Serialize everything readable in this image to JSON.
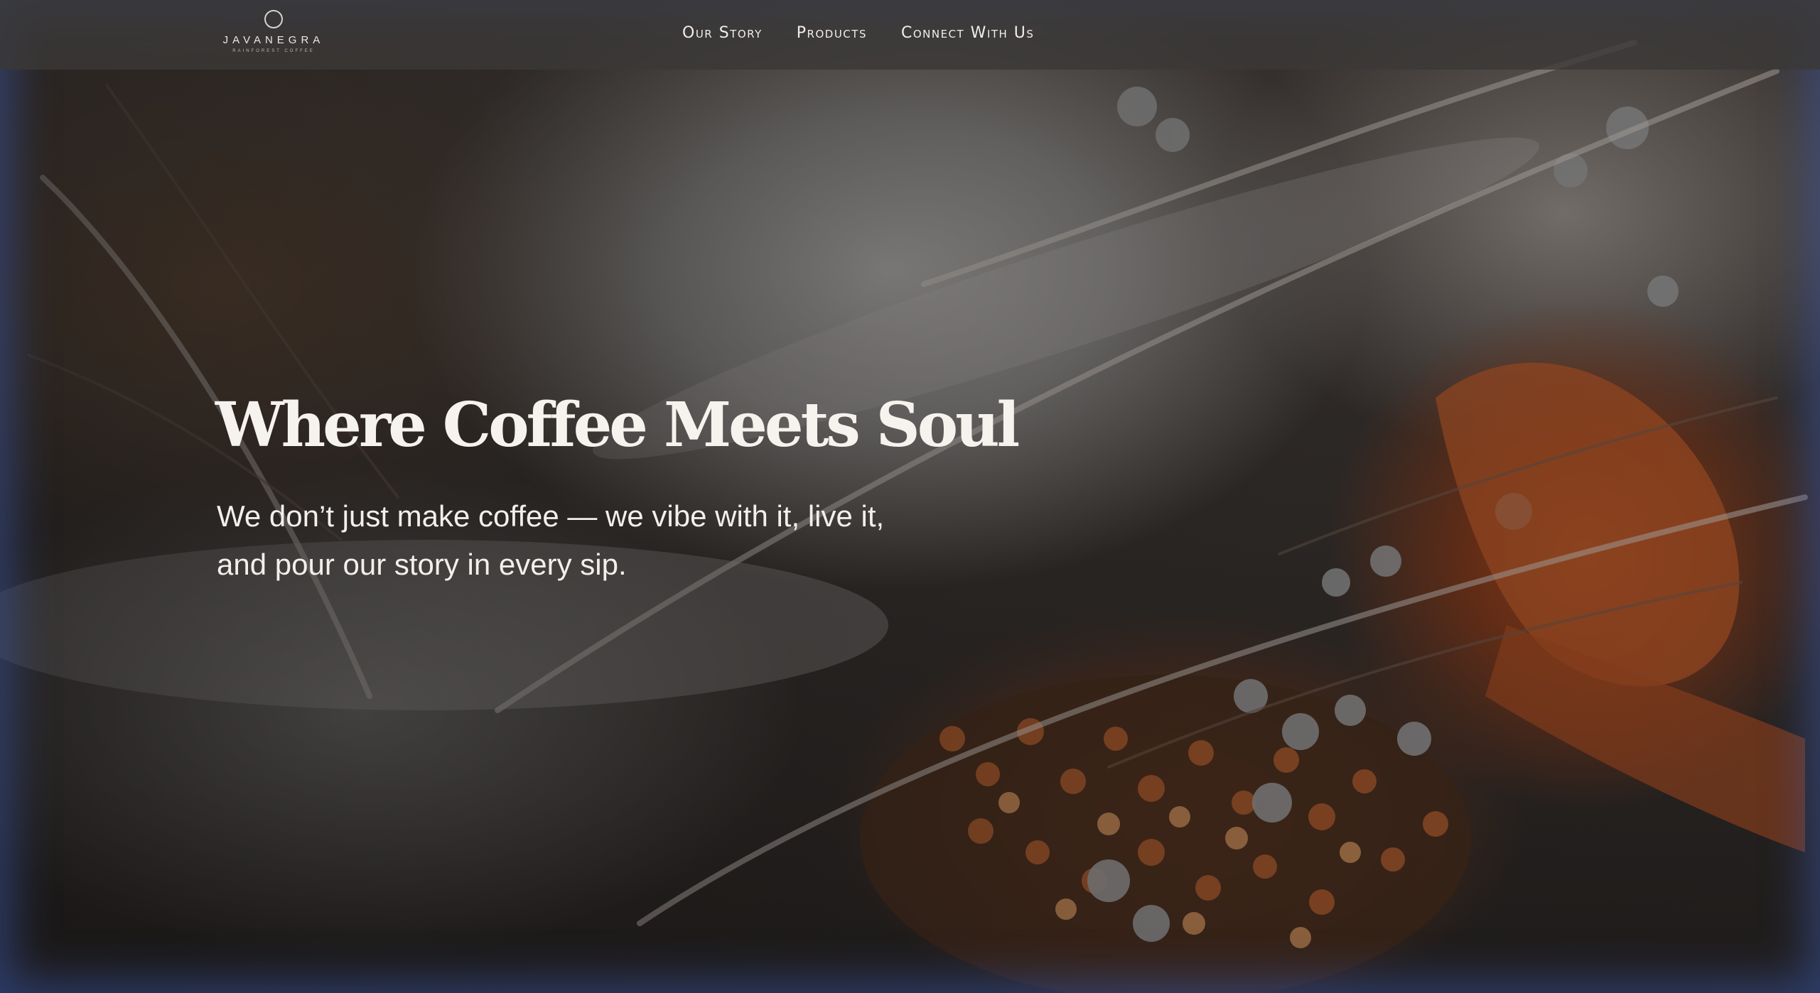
{
  "brand": {
    "name": "JAVANEGRA",
    "tagline": "RAINFOREST COFFEE",
    "logo_icon": "circle-logo-icon"
  },
  "nav": {
    "items": [
      {
        "label": "Our Story"
      },
      {
        "label": "Products"
      },
      {
        "label": "Connect With Us"
      }
    ]
  },
  "hero": {
    "title": "Where Coffee Meets Soul",
    "subtitle": "We don’t just make coffee — we vibe with it, live it, and pour our story in every sip."
  },
  "colors": {
    "nav_bar": "#3a3837",
    "text_light": "#f6f2ee",
    "accent_orange": "#8a3f1c"
  }
}
